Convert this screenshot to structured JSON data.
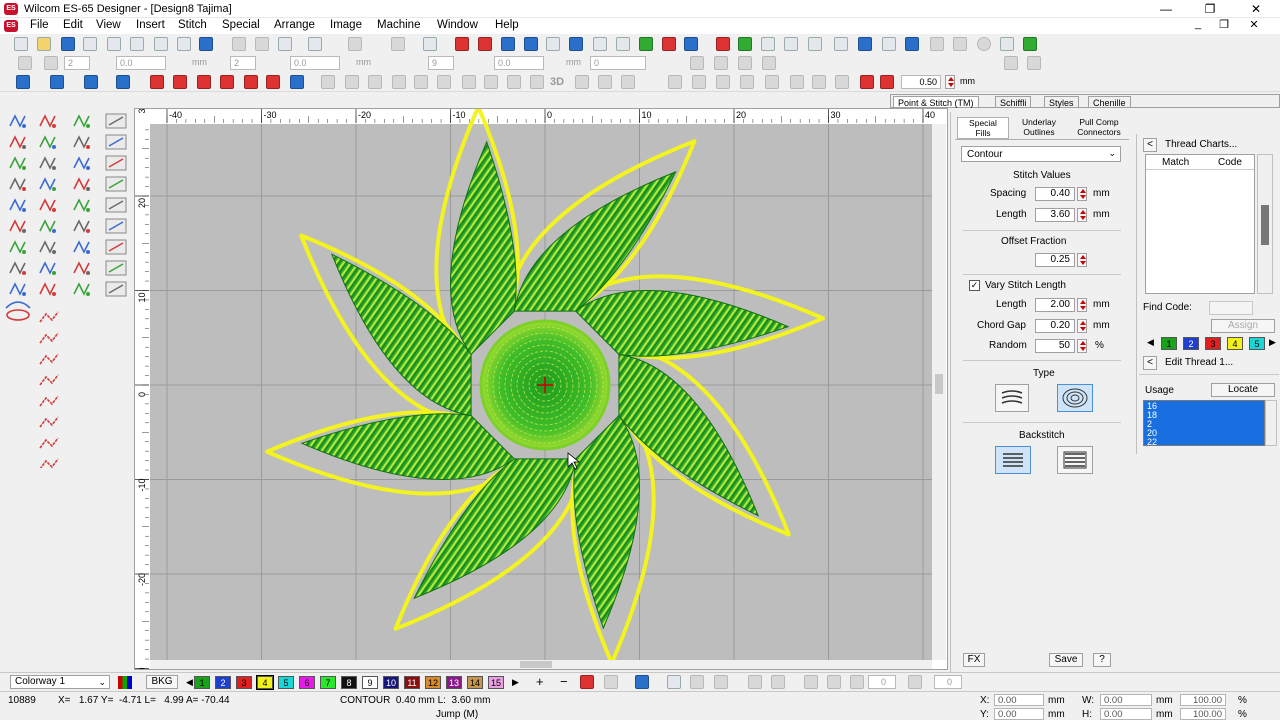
{
  "window": {
    "title": "Wilcom ES-65 Designer - [Design8        Tajima]",
    "minimize": "—",
    "restore": "❐",
    "close": "✕"
  },
  "menu": {
    "items": [
      "File",
      "Edit",
      "View",
      "Insert",
      "Stitch",
      "Special",
      "Arrange",
      "Image",
      "Machine",
      "Window",
      "Help"
    ]
  },
  "toolbar": {
    "stitch_len_value": "0.50",
    "stitch_len_unit": "mm",
    "field_values": [
      "2",
      "0.0",
      "2",
      "0.0",
      "9",
      "0.0",
      "0"
    ],
    "mm_labels": [
      "mm",
      "mm",
      "mm",
      "mm"
    ],
    "label_3d": "3D"
  },
  "ruler": {
    "top_labels": [
      "40",
      "30",
      "20",
      "10",
      "0",
      "10",
      "20",
      "30",
      "40"
    ],
    "left_labels": [
      "30",
      "20",
      "10",
      "0",
      "10",
      "20",
      "30"
    ]
  },
  "right_tabs": [
    "Point & Stitch (TM)",
    "Schiffli",
    "Styles",
    "Chenille"
  ],
  "obj_tabs": [
    {
      "line1": "Special",
      "line2": "Fills"
    },
    {
      "line1": "Underlay",
      "line2": "Outlines"
    },
    {
      "line1": "Pull Comp",
      "line2": "Connectors"
    }
  ],
  "props": {
    "fill_type": "Contour",
    "stitch_values_header": "Stitch Values",
    "spacing_label": "Spacing",
    "spacing_value": "0.40",
    "length_label": "Length",
    "length_value": "3.60",
    "unit_mm": "mm",
    "offset_fraction_header": "Offset Fraction",
    "offset_fraction_value": "0.25",
    "vary_stitch_label": "Vary Stitch Length",
    "vary_length_label": "Length",
    "vary_length_value": "2.00",
    "chord_gap_label": "Chord Gap",
    "chord_gap_value": "0.20",
    "random_label": "Random",
    "random_value": "50",
    "random_unit": "%",
    "type_header": "Type",
    "backstitch_header": "Backstitch",
    "fx_label": "FX",
    "save_label": "Save",
    "help_label": "?"
  },
  "thread_panel": {
    "title": "Thread Charts...",
    "col_match": "Match",
    "col_code": "Code",
    "find_code_label": "Find Code:",
    "assign_label": "Assign",
    "edit_thread_label": "Edit Thread 1...",
    "usage_label": "Usage",
    "locate_label": "Locate",
    "usage_items": [
      "16",
      "18",
      "2",
      "20",
      "22"
    ],
    "mini_swatches": [
      "1",
      "2",
      "3",
      "4",
      "5"
    ]
  },
  "colorbar": {
    "colorway": "Colorway 1",
    "bkg": "BKG",
    "swatches": [
      {
        "n": "1",
        "bg": "#1aa31a",
        "fg": "#000"
      },
      {
        "n": "2",
        "bg": "#1f3fd0",
        "fg": "#fff"
      },
      {
        "n": "3",
        "bg": "#e02020",
        "fg": "#000"
      },
      {
        "n": "4",
        "bg": "#f2f21a",
        "fg": "#000"
      },
      {
        "n": "5",
        "bg": "#1ad6d6",
        "fg": "#000"
      },
      {
        "n": "6",
        "bg": "#e81ae8",
        "fg": "#000"
      },
      {
        "n": "7",
        "bg": "#2ce62c",
        "fg": "#000"
      },
      {
        "n": "8",
        "bg": "#111111",
        "fg": "#fff"
      },
      {
        "n": "9",
        "bg": "#ffffff",
        "fg": "#000"
      },
      {
        "n": "10",
        "bg": "#15157a",
        "fg": "#fff"
      },
      {
        "n": "11",
        "bg": "#8a1010",
        "fg": "#fff"
      },
      {
        "n": "12",
        "bg": "#d98a2a",
        "fg": "#000"
      },
      {
        "n": "13",
        "bg": "#8a1a8a",
        "fg": "#fff"
      },
      {
        "n": "14",
        "bg": "#c49650",
        "fg": "#000"
      },
      {
        "n": "15",
        "bg": "#e8a0e0",
        "fg": "#000"
      }
    ],
    "counter_values": [
      "0",
      "0"
    ]
  },
  "status": {
    "stitch_count": "10889",
    "coords": "X=   1.67 Y=  -4.71 L=   4.99 A= -70.44",
    "object": "CONTOUR  0.40 mm L:  3.60 mm",
    "jump": "Jump (M)",
    "x_label": "X:",
    "x_value": "0.00",
    "y_label": "Y:",
    "y_value": "0.00",
    "w_label": "W:",
    "w_value": "0.00",
    "h_label": "H:",
    "h_value": "0.00",
    "mm": "mm",
    "pct_value": "100.00",
    "pct": "%"
  },
  "colors": {
    "canvas_bg": "#bcbcbc",
    "flower_dark": "#1f9a1f",
    "flower_light": "#8ad62a",
    "outline_yellow": "#f3f31f",
    "selection_blue": "#1a6fe0"
  }
}
